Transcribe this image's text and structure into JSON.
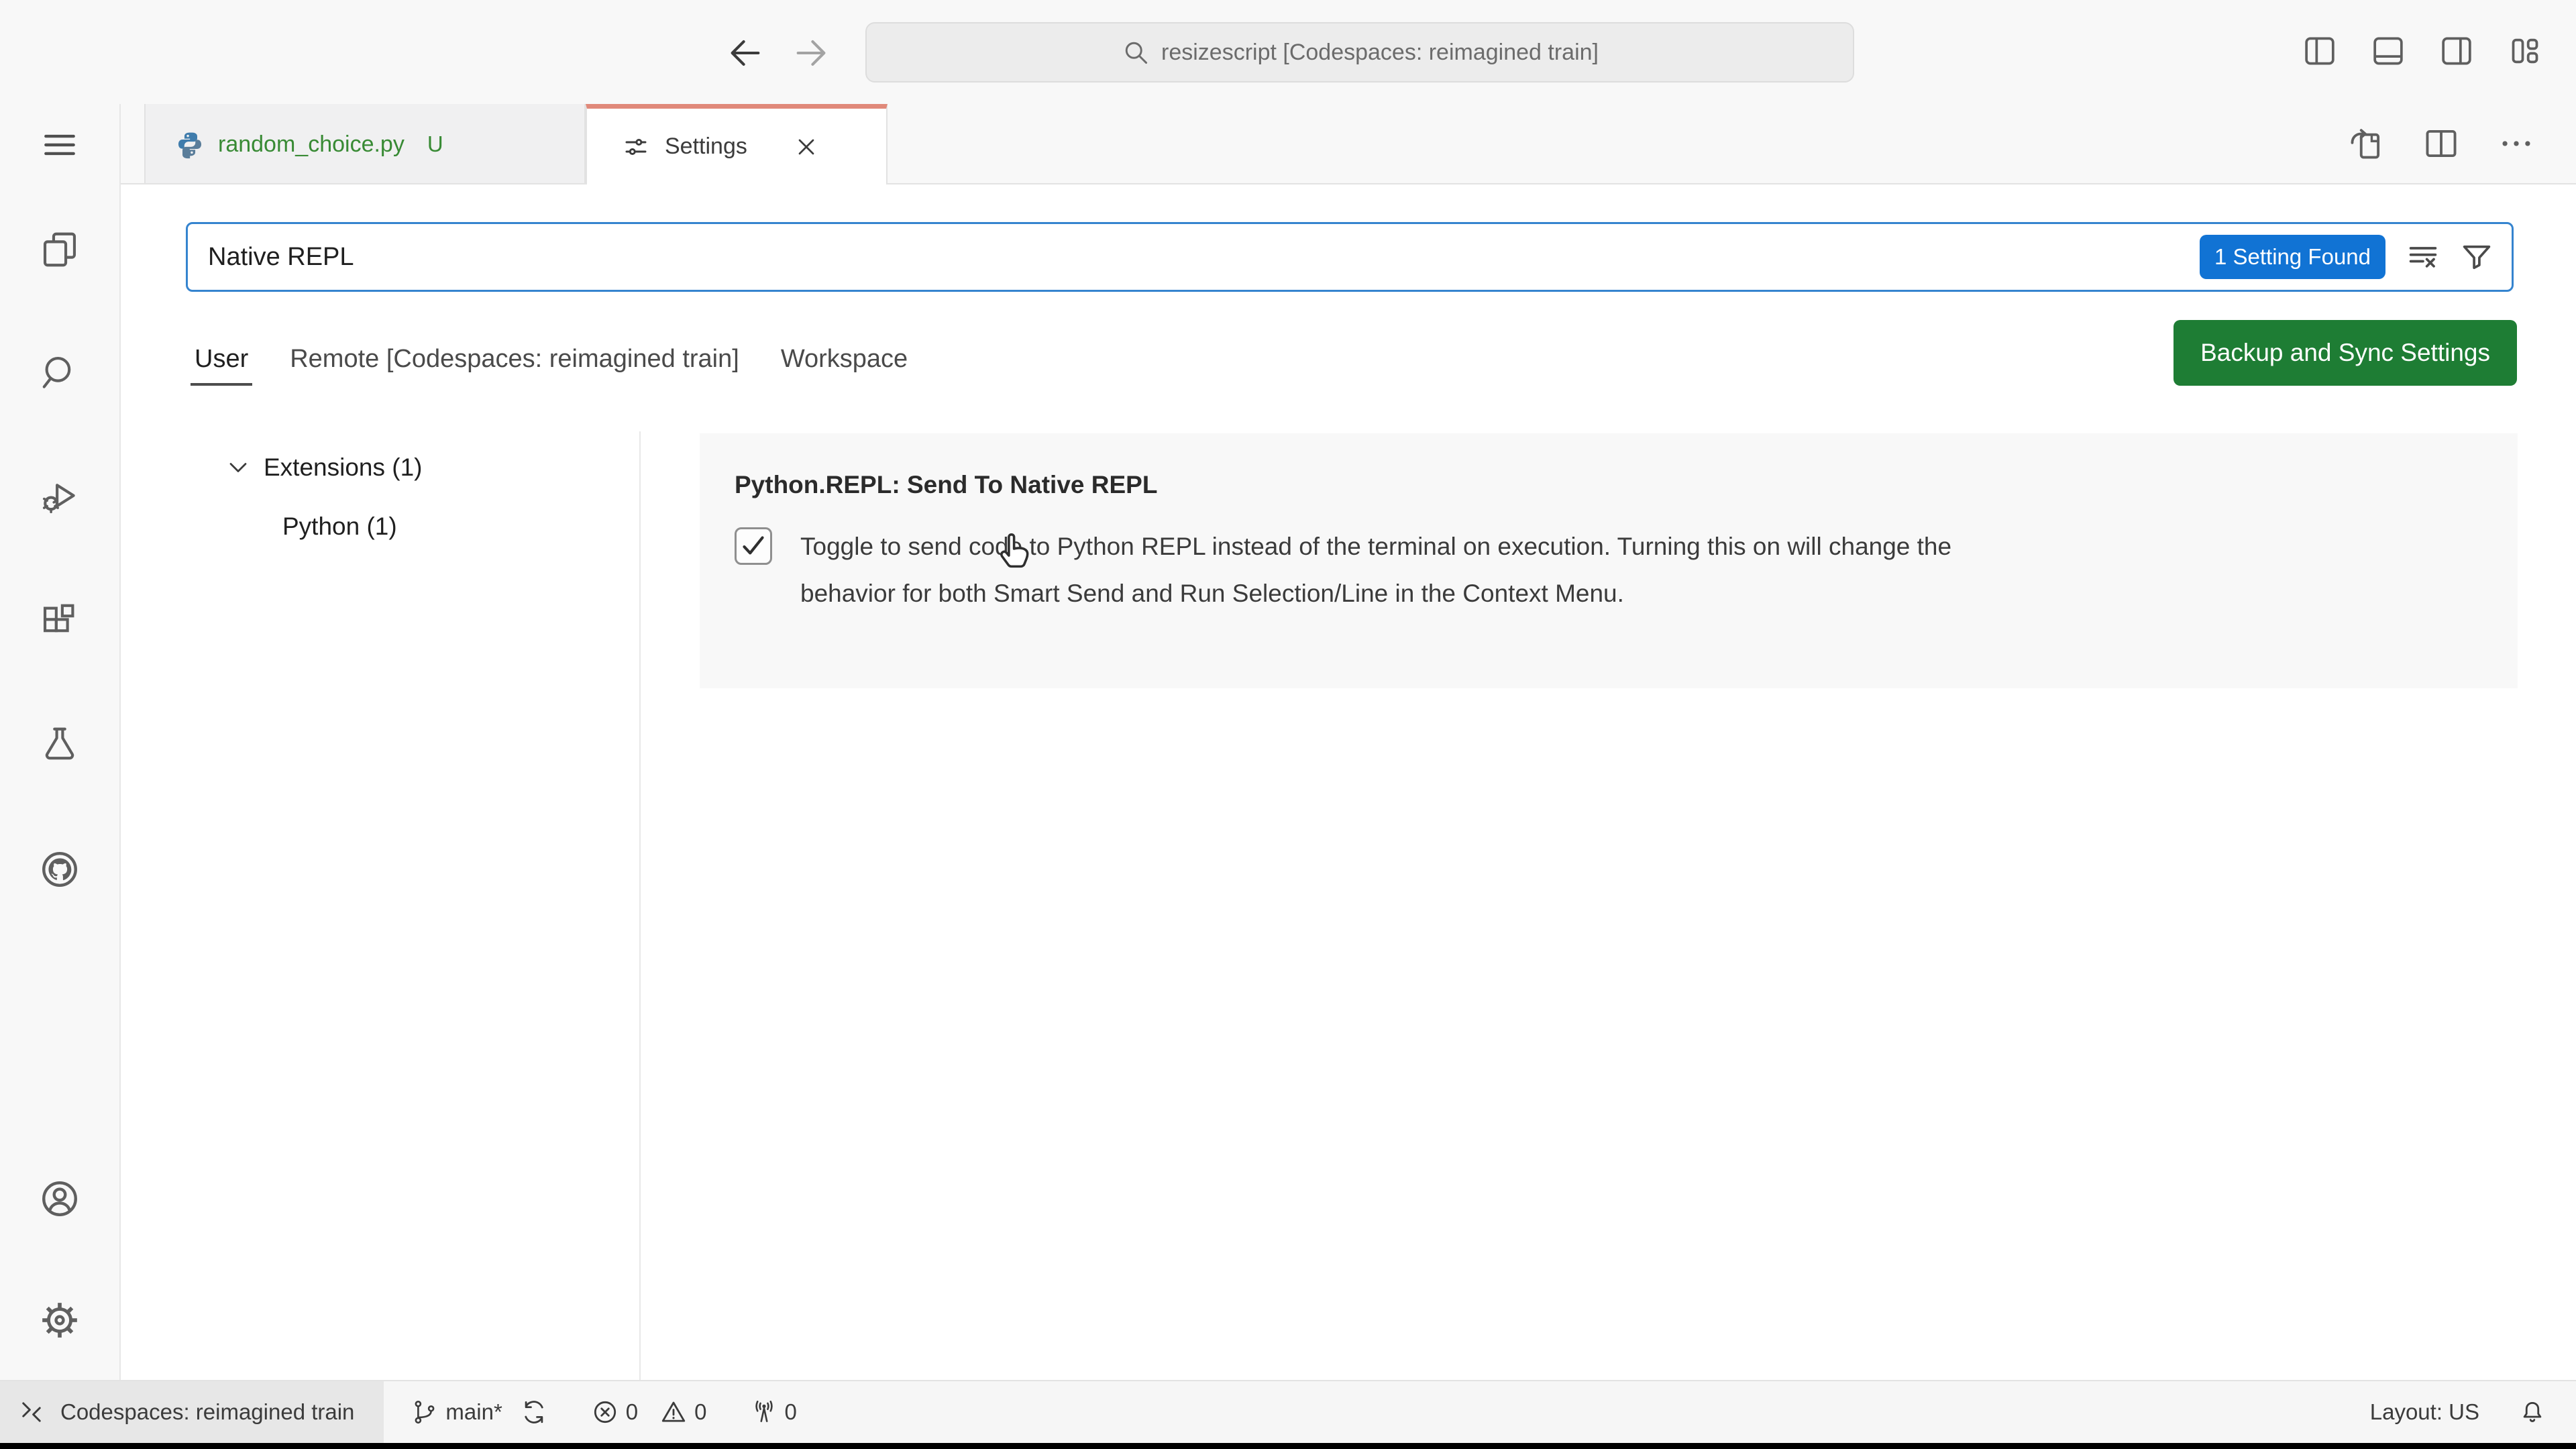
{
  "titlebar": {
    "command_center_text": "resizescript [Codespaces: reimagined train]"
  },
  "editor_tabs": {
    "tab1": {
      "label": "random_choice.py",
      "git_badge": "U"
    },
    "tab2": {
      "label": "Settings"
    }
  },
  "settings_editor": {
    "search": {
      "value": "Native REPL",
      "results_badge": "1 Setting Found"
    },
    "scopes": {
      "user": "User",
      "remote": "Remote [Codespaces: reimagined train]",
      "workspace": "Workspace"
    },
    "backup_button_label": "Backup and Sync Settings",
    "toc": {
      "extensions": "Extensions (1)",
      "python": "Python (1)"
    },
    "setting": {
      "title": "Python.REPL: Send To Native REPL",
      "checkbox_checked": true,
      "description_line1": "Toggle to send code to Python REPL instead of the terminal on execution. Turning this on will change the",
      "description_line2": "behavior for both Smart Send and Run Selection/Line in the Context Menu."
    }
  },
  "statusbar": {
    "remote_label": "Codespaces: reimagined train",
    "branch": "main*",
    "errors": "0",
    "warnings": "0",
    "ports": "0",
    "layout": "Layout: US"
  },
  "icons": {
    "back-icon": "left-arrow",
    "forward-icon": "right-arrow",
    "search-icon": "magnifier",
    "toggle-sidebar-icon": "square-split-left",
    "toggle-panel-icon": "square-split-bottom",
    "toggle-secondary-sidebar-icon": "square-split-right",
    "customize-layout-icon": "layout-grid",
    "menu-icon": "hamburger",
    "explorer-icon": "stacked-files",
    "search-view-icon": "magnifier",
    "run-debug-icon": "play-with-bug",
    "extensions-icon": "four-squares",
    "testing-icon": "beaker",
    "github-icon": "octocat-circle",
    "account-icon": "person-circle",
    "settings-gear-icon": "gear",
    "python-icon": "python-logo",
    "settings-sliders-icon": "sliders",
    "close-icon": "x",
    "open-settings-json-icon": "file-with-arrow",
    "split-editor-icon": "square-split",
    "more-actions-icon": "ellipsis",
    "clear-filters-icon": "lines-with-x",
    "filter-icon": "funnel",
    "chevron-down-icon": "chevron-down",
    "checkmark-icon": "check",
    "remote-indicator-icon": "angle-brackets",
    "git-branch-icon": "branch",
    "sync-icon": "circular-arrows",
    "error-icon": "circle-x",
    "warning-icon": "triangle-exclaim",
    "ports-icon": "radio-tower",
    "bell-icon": "bell",
    "mouse-cursor": "hand-pointer"
  },
  "colors": {
    "focus_border": "#3584cf",
    "results_badge_bg": "#1173d4",
    "backup_button_bg": "#1e7d34",
    "active_tab_accent": "#e0897a",
    "git_untracked_green": "#388a34",
    "icon_gray": "#5f5f5f",
    "chrome_bg": "#f8f8f8",
    "setting_row_bg": "#f8f8f8"
  }
}
